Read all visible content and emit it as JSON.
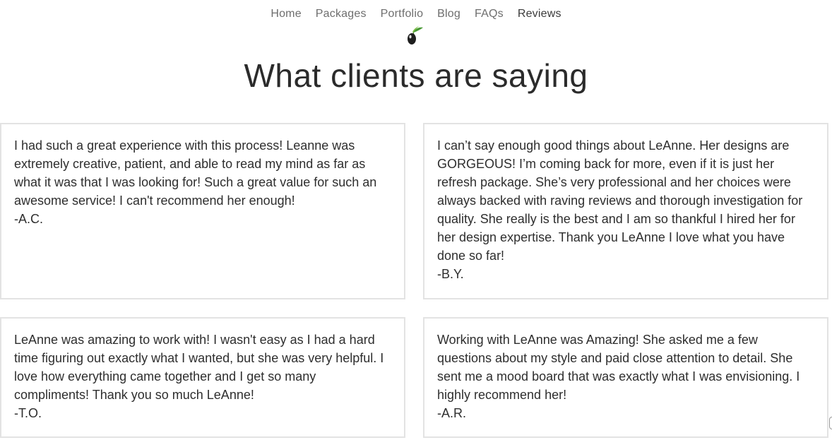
{
  "nav": {
    "items": [
      {
        "label": "Home"
      },
      {
        "label": "Packages"
      },
      {
        "label": "Portfolio"
      },
      {
        "label": "Blog"
      },
      {
        "label": "FAQs"
      },
      {
        "label": "Reviews"
      }
    ],
    "active": "Reviews"
  },
  "logo": {
    "icon": "olive-icon",
    "colors": {
      "fruit": "#1e1e1e",
      "leaf": "#3f8f2e"
    }
  },
  "page": {
    "title": "What clients are saying"
  },
  "reviews": [
    {
      "text": "I had such a great experience with this process! Leanne was extremely creative, patient, and able to read my mind as far as what it was that I was looking for! Such a great value for such an awesome service! I can't recommend her enough!",
      "author": "-A.C."
    },
    {
      "text": "I can’t say enough good things about LeAnne. Her designs are GORGEOUS! I’m coming back for more, even if it is just her refresh package. She’s very professional and her choices were always backed with raving reviews and thorough investigation for quality. She really is the best and I am so thankful I hired her for her design expertise. Thank you LeAnne I love what you have done so far!",
      "author": "-B.Y."
    },
    {
      "text": "LeAnne was amazing to work with! I wasn't easy as I had a hard time figuring out exactly what I wanted, but she was very helpful. I love how everything came together and I get so many compliments! Thank you so much LeAnne!",
      "author": "-T.O."
    },
    {
      "text": "Working with LeAnne was Amazing! She asked me a few questions about my style and paid close attention to detail. She sent me a mood board that was exactly what I was envisioning. I highly recommend her!",
      "author": "-A.R."
    }
  ]
}
